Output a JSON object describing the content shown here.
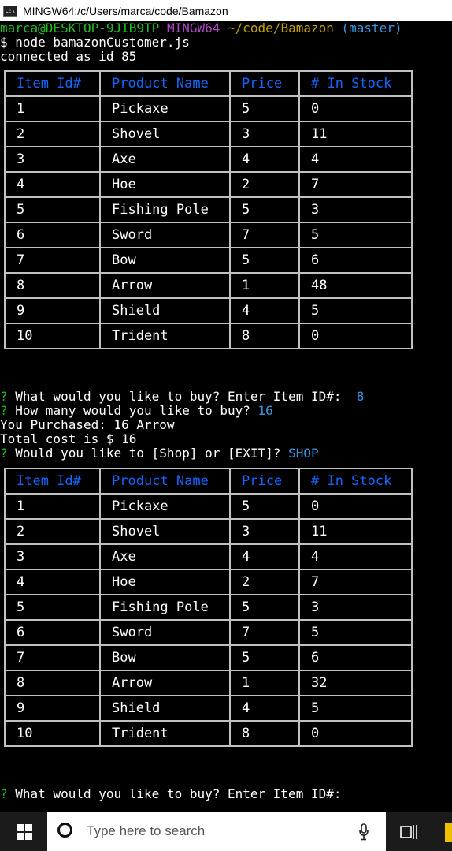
{
  "window": {
    "title": "MINGW64:/c/Users/marca/code/Bamazon"
  },
  "prompt": {
    "user_host": "marca@DESKTOP-9JIB9TP",
    "env": "MINGW64",
    "path": "~/code/Bamazon",
    "branch": "(master)"
  },
  "command": "$ node bamazonCustomer.js",
  "connected": "connected as id 85",
  "table": {
    "headers": [
      "Item Id#",
      "Product Name",
      "Price",
      "# In Stock"
    ]
  },
  "inventory_before": [
    [
      "1",
      "Pickaxe",
      "5",
      "0"
    ],
    [
      "2",
      "Shovel",
      "3",
      "11"
    ],
    [
      "3",
      "Axe",
      "4",
      "4"
    ],
    [
      "4",
      "Hoe",
      "2",
      "7"
    ],
    [
      "5",
      "Fishing Pole",
      "5",
      "3"
    ],
    [
      "6",
      "Sword",
      "7",
      "5"
    ],
    [
      "7",
      "Bow",
      "5",
      "6"
    ],
    [
      "8",
      "Arrow",
      "1",
      "48"
    ],
    [
      "9",
      "Shield",
      "4",
      "5"
    ],
    [
      "10",
      "Trident",
      "8",
      "0"
    ]
  ],
  "inventory_after": [
    [
      "1",
      "Pickaxe",
      "5",
      "0"
    ],
    [
      "2",
      "Shovel",
      "3",
      "11"
    ],
    [
      "3",
      "Axe",
      "4",
      "4"
    ],
    [
      "4",
      "Hoe",
      "2",
      "7"
    ],
    [
      "5",
      "Fishing Pole",
      "5",
      "3"
    ],
    [
      "6",
      "Sword",
      "7",
      "5"
    ],
    [
      "7",
      "Bow",
      "5",
      "6"
    ],
    [
      "8",
      "Arrow",
      "1",
      "32"
    ],
    [
      "9",
      "Shield",
      "4",
      "5"
    ],
    [
      "10",
      "Trident",
      "8",
      "0"
    ]
  ],
  "dialog": {
    "q_marker": "?",
    "q_item": " What would you like to buy? Enter Item ID#:",
    "a_item": "8",
    "q_qty": " How many would you like to buy?",
    "a_qty": "16",
    "purchased": "You Purchased: 16 Arrow",
    "total": "Total cost is $ 16",
    "q_shop": " Would you like to [Shop] or [EXIT]?",
    "a_shop": "SHOP",
    "q_item_again": " What would you like to buy? Enter Item ID#:"
  },
  "taskbar": {
    "search_placeholder": "Type here to search"
  },
  "colors": {
    "terminal_bg": "#000000",
    "prompt_green": "#1fc01f",
    "env_magenta": "#b148c6",
    "path_yellow": "#c1a000",
    "answer_cyan": "#3a96dd",
    "header_blue": "#1565ff"
  },
  "icons": {
    "app": "terminal-icon",
    "start": "windows-logo-icon",
    "search": "search-circle-icon",
    "mic": "microphone-icon",
    "task_view": "task-view-icon"
  }
}
